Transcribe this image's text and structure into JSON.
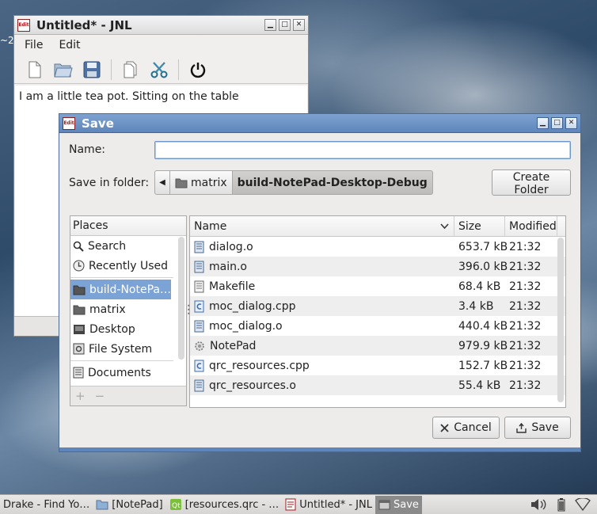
{
  "desktop": {
    "edge_text": "~2"
  },
  "main_window": {
    "title": "Untitled* - JNL",
    "icon_text": "Edit",
    "controls": {
      "minimize": "▁",
      "maximize": "□",
      "close": "✕"
    },
    "menu": [
      "File",
      "Edit"
    ],
    "toolbar": [
      "new-file-icon",
      "open-folder-icon",
      "save-disk-icon",
      "copy-icon",
      "cut-scissors-icon",
      "power-icon"
    ],
    "editor_text": "I am a little tea pot. Sitting on the table"
  },
  "dialog": {
    "title": "Save",
    "controls": {
      "minimize": "▁",
      "maximize": "□",
      "close": "✕"
    },
    "name_label": "Name:",
    "name_value": "",
    "folder_label": "Save in folder:",
    "path": [
      "matrix",
      "build-NotePad-Desktop-Debug"
    ],
    "create_folder": "Create Folder",
    "places_header": "Places",
    "places": [
      {
        "label": "Search",
        "icon": "search-icon"
      },
      {
        "label": "Recently Used",
        "icon": "clock-icon"
      },
      {
        "label": "build-NotePa…",
        "icon": "folder-icon",
        "selected": true
      },
      {
        "label": "matrix",
        "icon": "folder-icon"
      },
      {
        "label": "Desktop",
        "icon": "desktop-icon"
      },
      {
        "label": "File System",
        "icon": "drive-icon"
      },
      {
        "label": "Documents",
        "icon": "document-icon"
      }
    ],
    "places_footer": {
      "add": "+",
      "remove": "−"
    },
    "columns": {
      "name": "Name",
      "size": "Size",
      "modified": "Modified"
    },
    "files": [
      {
        "name": "dialog.o",
        "size": "653.7 kB",
        "modified": "21:32",
        "icon": "binary-file-icon"
      },
      {
        "name": "main.o",
        "size": "396.0 kB",
        "modified": "21:32",
        "icon": "binary-file-icon"
      },
      {
        "name": "Makefile",
        "size": "68.4 kB",
        "modified": "21:32",
        "icon": "text-file-icon"
      },
      {
        "name": "moc_dialog.cpp",
        "size": "3.4 kB",
        "modified": "21:32",
        "icon": "source-file-icon"
      },
      {
        "name": "moc_dialog.o",
        "size": "440.4 kB",
        "modified": "21:32",
        "icon": "binary-file-icon"
      },
      {
        "name": "NotePad",
        "size": "979.9 kB",
        "modified": "21:32",
        "icon": "executable-icon"
      },
      {
        "name": "qrc_resources.cpp",
        "size": "152.7 kB",
        "modified": "21:32",
        "icon": "source-file-icon"
      },
      {
        "name": "qrc_resources.o",
        "size": "55.4 kB",
        "modified": "21:32",
        "icon": "binary-file-icon"
      }
    ],
    "cancel": "Cancel",
    "save": "Save"
  },
  "taskbar": {
    "tasks": [
      {
        "label": "Drake - Find Yo…",
        "icon": ""
      },
      {
        "label": "[NotePad]",
        "icon": "folder-icon"
      },
      {
        "label": "[resources.qrc - …",
        "icon": "qt-icon"
      },
      {
        "label": "Untitled* - JNL",
        "icon": "edit-icon"
      },
      {
        "label": "Save",
        "icon": "window-icon",
        "active": true
      }
    ],
    "tray": [
      "volume-icon",
      "battery-icon",
      "wifi-icon"
    ]
  },
  "colors": {
    "dialog_title": "#6a8fc3",
    "selection": "#7ba3d6"
  }
}
